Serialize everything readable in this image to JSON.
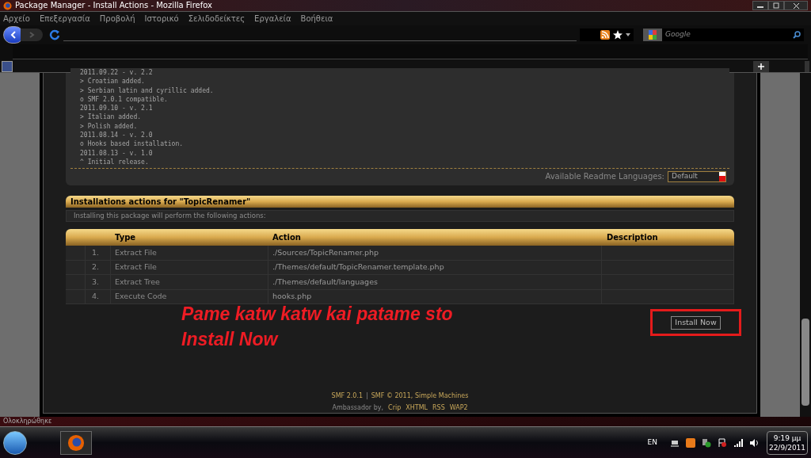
{
  "window": {
    "title": "Package Manager - Install Actions - Mozilla Firefox"
  },
  "menu": [
    "Αρχείο",
    "Επεξεργασία",
    "Προβολή",
    "Ιστορικό",
    "Σελιδοδείκτες",
    "Εργαλεία",
    "Βοήθεια"
  ],
  "search": {
    "placeholder": "Google"
  },
  "readme": {
    "lines": [
      "2011.09.22 - v. 2.2",
      "> Croatian added.",
      "> Serbian latin and cyrillic added.",
      "o SMF 2.0.1 compatible.",
      "2011.09.10 - v. 2.1",
      "> Italian added.",
      "> Polish added.",
      "2011.08.14 - v. 2.0",
      "o Hooks based installation.",
      "2011.08.13 - v. 1.0",
      "^ Initial release."
    ],
    "languages_label": "Available Readme Languages:",
    "language_value": "Default"
  },
  "section": {
    "title": "Installations actions for \"TopicRenamer\"",
    "description": "Installing this package will perform the following actions:"
  },
  "table": {
    "columns": [
      "Type",
      "Action",
      "Description"
    ],
    "rows": [
      {
        "number": "1.",
        "type": "Extract File",
        "action": "./Sources/TopicRenamer.php"
      },
      {
        "number": "2.",
        "type": "Extract File",
        "action": "./Themes/default/TopicRenamer.template.php"
      },
      {
        "number": "3.",
        "type": "Extract Tree",
        "action": "./Themes/default/languages"
      },
      {
        "number": "4.",
        "type": "Execute Code",
        "action": "hooks.php"
      }
    ]
  },
  "install_button": "Install Now",
  "annotation": [
    "Pame katw katw kai patame sto",
    "Install Now"
  ],
  "footer": {
    "line_1": [
      {
        "kind": "link",
        "text": "SMF 2.0.1"
      },
      {
        "kind": "text",
        "text": "|"
      },
      {
        "kind": "link",
        "text": "SMF © 2011, Simple Machines"
      }
    ],
    "line_2": [
      {
        "kind": "text",
        "text": "Ambassador by,"
      },
      {
        "kind": "link",
        "text": "Crip"
      },
      {
        "kind": "link",
        "text": "XHTML"
      },
      {
        "kind": "link",
        "text": "RSS"
      },
      {
        "kind": "link",
        "text": "WAP2"
      }
    ]
  },
  "status_bar": "Ολοκληρώθηκε",
  "taskbar": {
    "language": "EN",
    "time": "9:19 μμ",
    "date": "22/9/2011"
  }
}
